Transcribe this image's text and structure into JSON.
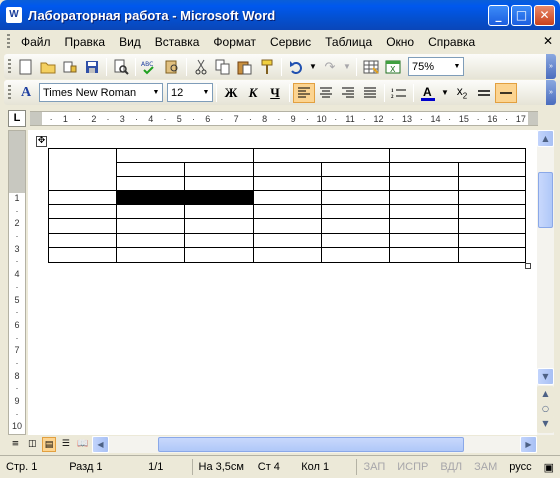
{
  "window": {
    "title": "Лабораторная работа - Microsoft Word",
    "app_icon": "W"
  },
  "menu": {
    "items": [
      "Файл",
      "Правка",
      "Вид",
      "Вставка",
      "Формат",
      "Сервис",
      "Таблица",
      "Окно",
      "Справка"
    ]
  },
  "toolbar_standard": {
    "zoom": "75%"
  },
  "toolbar_format": {
    "style_icon": "A",
    "font_name": "Times New Roman",
    "font_size": "12",
    "bold": "Ж",
    "italic": "К",
    "underline": "Ч",
    "align_left_active": true,
    "font_color": "#0000cc",
    "highlight_color": "#fcd490"
  },
  "ruler": {
    "corner": "L",
    "h_ticks": [
      "·",
      "1",
      "·",
      "2",
      "·",
      "3",
      "·",
      "4",
      "·",
      "5",
      "·",
      "6",
      "·",
      "7",
      "·",
      "8",
      "·",
      "9",
      "·",
      "10",
      "·",
      "11",
      "·",
      "12",
      "·",
      "13",
      "·",
      "14",
      "·",
      "15",
      "·",
      "16",
      "·",
      "17"
    ],
    "v_ticks": [
      "1",
      "·",
      "2",
      "·",
      "3",
      "·",
      "4",
      "·",
      "5",
      "·",
      "6",
      "·",
      "7",
      "·",
      "8",
      "·",
      "9",
      "·",
      "10"
    ]
  },
  "status": {
    "page": "Стр. 1",
    "section": "Разд 1",
    "pages": "1/1",
    "at": "На 3,5см",
    "line": "Ст 4",
    "col": "Кол 1",
    "rec": "ЗАП",
    "trk": "ИСПР",
    "ext": "ВДЛ",
    "ovr": "ЗАМ",
    "lang": "русс"
  }
}
